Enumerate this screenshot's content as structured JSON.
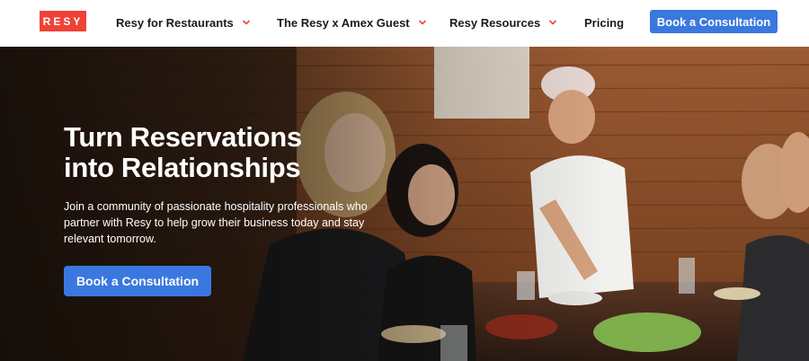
{
  "brand": {
    "logo_text": "RESY",
    "accent": "#ef4236"
  },
  "nav": {
    "items": [
      {
        "label": "Resy for Restaurants",
        "has_dropdown": true
      },
      {
        "label": "The Resy x Amex Guest",
        "has_dropdown": true
      },
      {
        "label": "Resy Resources",
        "has_dropdown": true
      },
      {
        "label": "Pricing",
        "has_dropdown": false
      }
    ],
    "cta_label": "Book a Consultation",
    "cta_color": "#3a78e0",
    "chevron_color": "#ef4236"
  },
  "hero": {
    "title_line1": "Turn Reservations",
    "title_line2": "into Relationships",
    "body": "Join a community of passionate hospitality professionals who partner with Resy to help grow their business today and stay relevant tomorrow.",
    "cta_label": "Book a Consultation",
    "image_subject": "restaurant-diners-photo"
  }
}
